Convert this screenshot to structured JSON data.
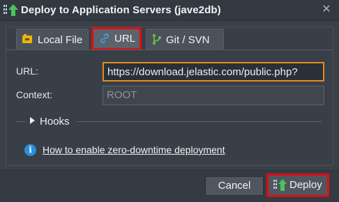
{
  "dialog": {
    "title": "Deploy to Application Servers (jave2db)",
    "title_icon": "deploy-arrow-icon",
    "close_icon": "close-icon"
  },
  "tabs": [
    {
      "label": "Local File",
      "icon": "archive-icon",
      "icon_color": "#f2b300",
      "selected": false
    },
    {
      "label": "URL",
      "icon": "link-icon",
      "icon_color": "#3fa0e6",
      "selected": true
    },
    {
      "label": "Git / SVN",
      "icon": "git-branch-icon",
      "icon_color": "#6cc04a",
      "selected": false
    }
  ],
  "form": {
    "url_label": "URL:",
    "url_value": "https://download.jelastic.com/public.php?",
    "context_label": "Context:",
    "context_placeholder": "ROOT"
  },
  "hooks": {
    "label": "Hooks"
  },
  "info": {
    "link_text": "How to enable zero-downtime deployment",
    "icon": "info-icon"
  },
  "footer": {
    "cancel_label": "Cancel",
    "deploy_label": "Deploy"
  },
  "colors": {
    "highlight_red": "#e00d12",
    "input_focus_orange": "#e48a1f",
    "info_blue": "#2a8fd8",
    "arrow_green": "#4cc35a"
  }
}
